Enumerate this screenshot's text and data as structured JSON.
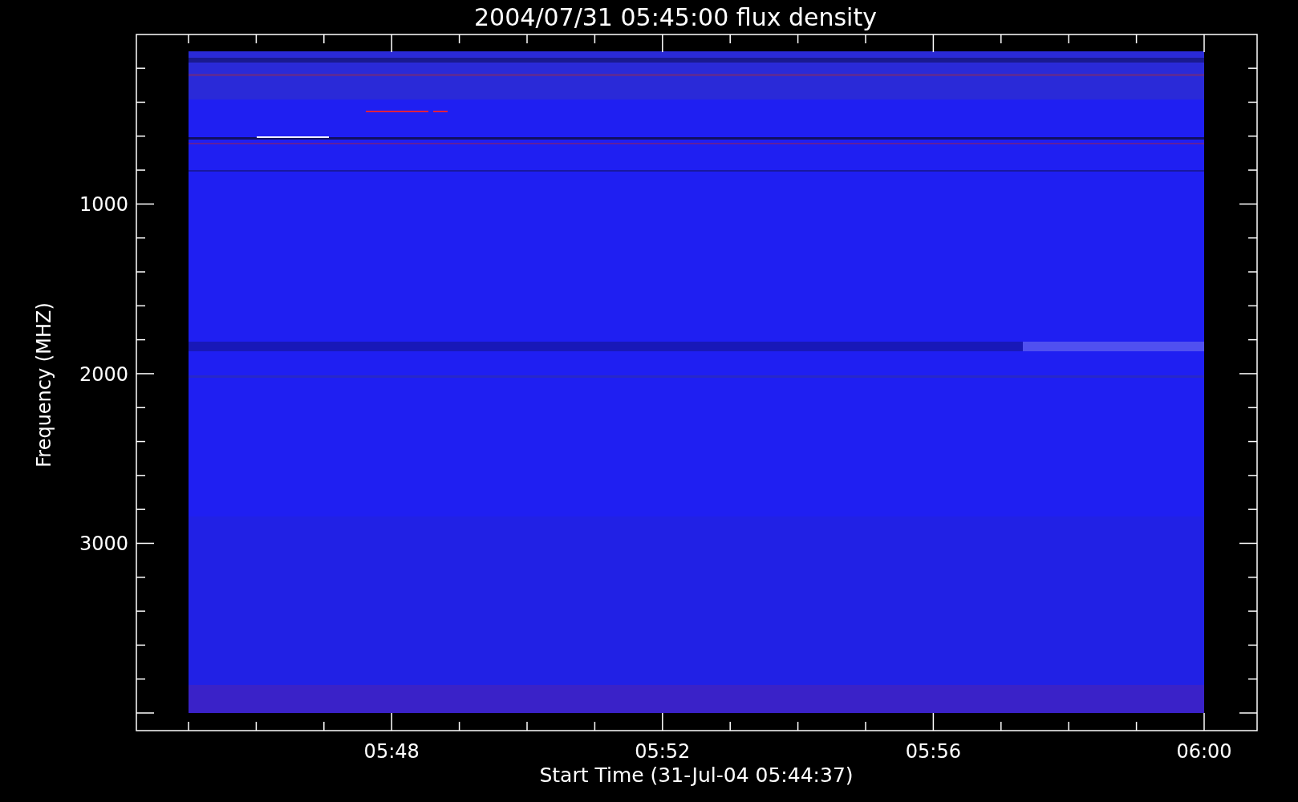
{
  "plot": {
    "title": "2004/07/31 05:45:00 flux density",
    "ylabel": "Frequency (MHZ)",
    "xlabel": "Start Time (31-Jul-04 05:44:37)",
    "xticks": [
      "05:48",
      "05:52",
      "05:56",
      "06:00"
    ],
    "yticks": [
      "1000",
      "2000",
      "3000"
    ]
  }
}
